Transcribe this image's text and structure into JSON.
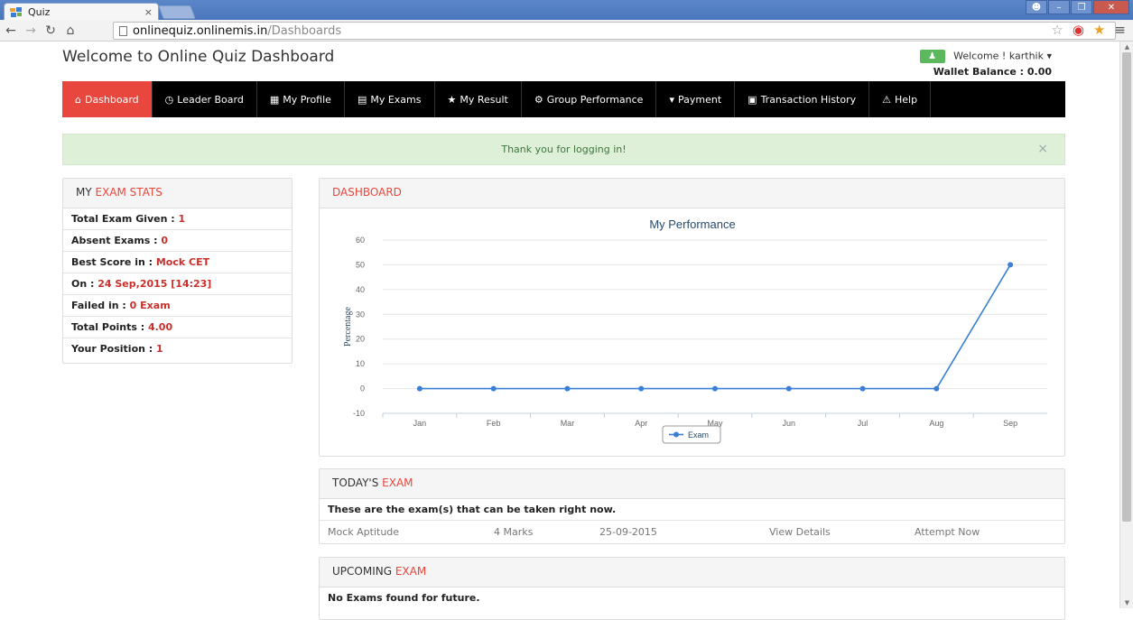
{
  "browser": {
    "tab_title": "Quiz",
    "tab_close": "×",
    "url_host": "onlinequiz.onlinemis.in",
    "url_path": "/Dashboards"
  },
  "page": {
    "title": "Welcome to Online Quiz Dashboard",
    "welcome": "Welcome ! karthik ▾",
    "wallet": "Wallet Balance : 0.00"
  },
  "menu": [
    {
      "label": "Dashboard",
      "icon": "home-icon"
    },
    {
      "label": "Leader Board",
      "icon": "clock-icon"
    },
    {
      "label": "My Profile",
      "icon": "th-icon"
    },
    {
      "label": "My Exams",
      "icon": "list-icon"
    },
    {
      "label": "My Result",
      "icon": "star-icon"
    },
    {
      "label": "Group Performance",
      "icon": "gear-icon"
    },
    {
      "label": "Payment",
      "icon": "cart-icon"
    },
    {
      "label": "Transaction History",
      "icon": "briefcase-icon"
    },
    {
      "label": "Help",
      "icon": "warning-icon"
    }
  ],
  "alert": {
    "text": "Thank you for logging in!",
    "close": "×"
  },
  "stats": {
    "head_a": "MY ",
    "head_b": "EXAM STATS",
    "rows": [
      {
        "label": "Total Exam Given : ",
        "value": "1"
      },
      {
        "label": "Absent Exams : ",
        "value": "0"
      },
      {
        "label": "Best Score in : ",
        "value": "Mock CET"
      },
      {
        "label": "On : ",
        "value": "24 Sep,2015 [14:23]"
      },
      {
        "label": "Failed in : ",
        "value": "0 Exam"
      },
      {
        "label": "Total Points : ",
        "value": "4.00"
      },
      {
        "label": "Your Position : ",
        "value": "1"
      }
    ]
  },
  "dashboard": {
    "head": "DASHBOARD"
  },
  "chart_data": {
    "type": "line",
    "title": "My Performance",
    "ylabel": "Percentage",
    "xlabel": "",
    "categories": [
      "Jan",
      "Feb",
      "Mar",
      "Apr",
      "May",
      "Jun",
      "Jul",
      "Aug",
      "Sep"
    ],
    "series": [
      {
        "name": "Exam",
        "values": [
          0,
          0,
          0,
          0,
          0,
          0,
          0,
          0,
          50
        ],
        "color": "#3a7fd5"
      }
    ],
    "yticks": [
      -10,
      0,
      10,
      20,
      30,
      40,
      50,
      60
    ],
    "ylim": [
      -10,
      60
    ],
    "grid": true,
    "legend": "bottom"
  },
  "today": {
    "head_a": "TODAY'S ",
    "head_b": "EXAM",
    "notice": "These are the exam(s) that can be taken right now.",
    "exam": {
      "name": "Mock Aptitude",
      "marks": "4 Marks",
      "date": "25-09-2015",
      "details": "View Details",
      "attempt": "Attempt Now"
    }
  },
  "upcoming": {
    "head_a": "UPCOMING ",
    "head_b": "EXAM",
    "notice": "No Exams found for future."
  }
}
